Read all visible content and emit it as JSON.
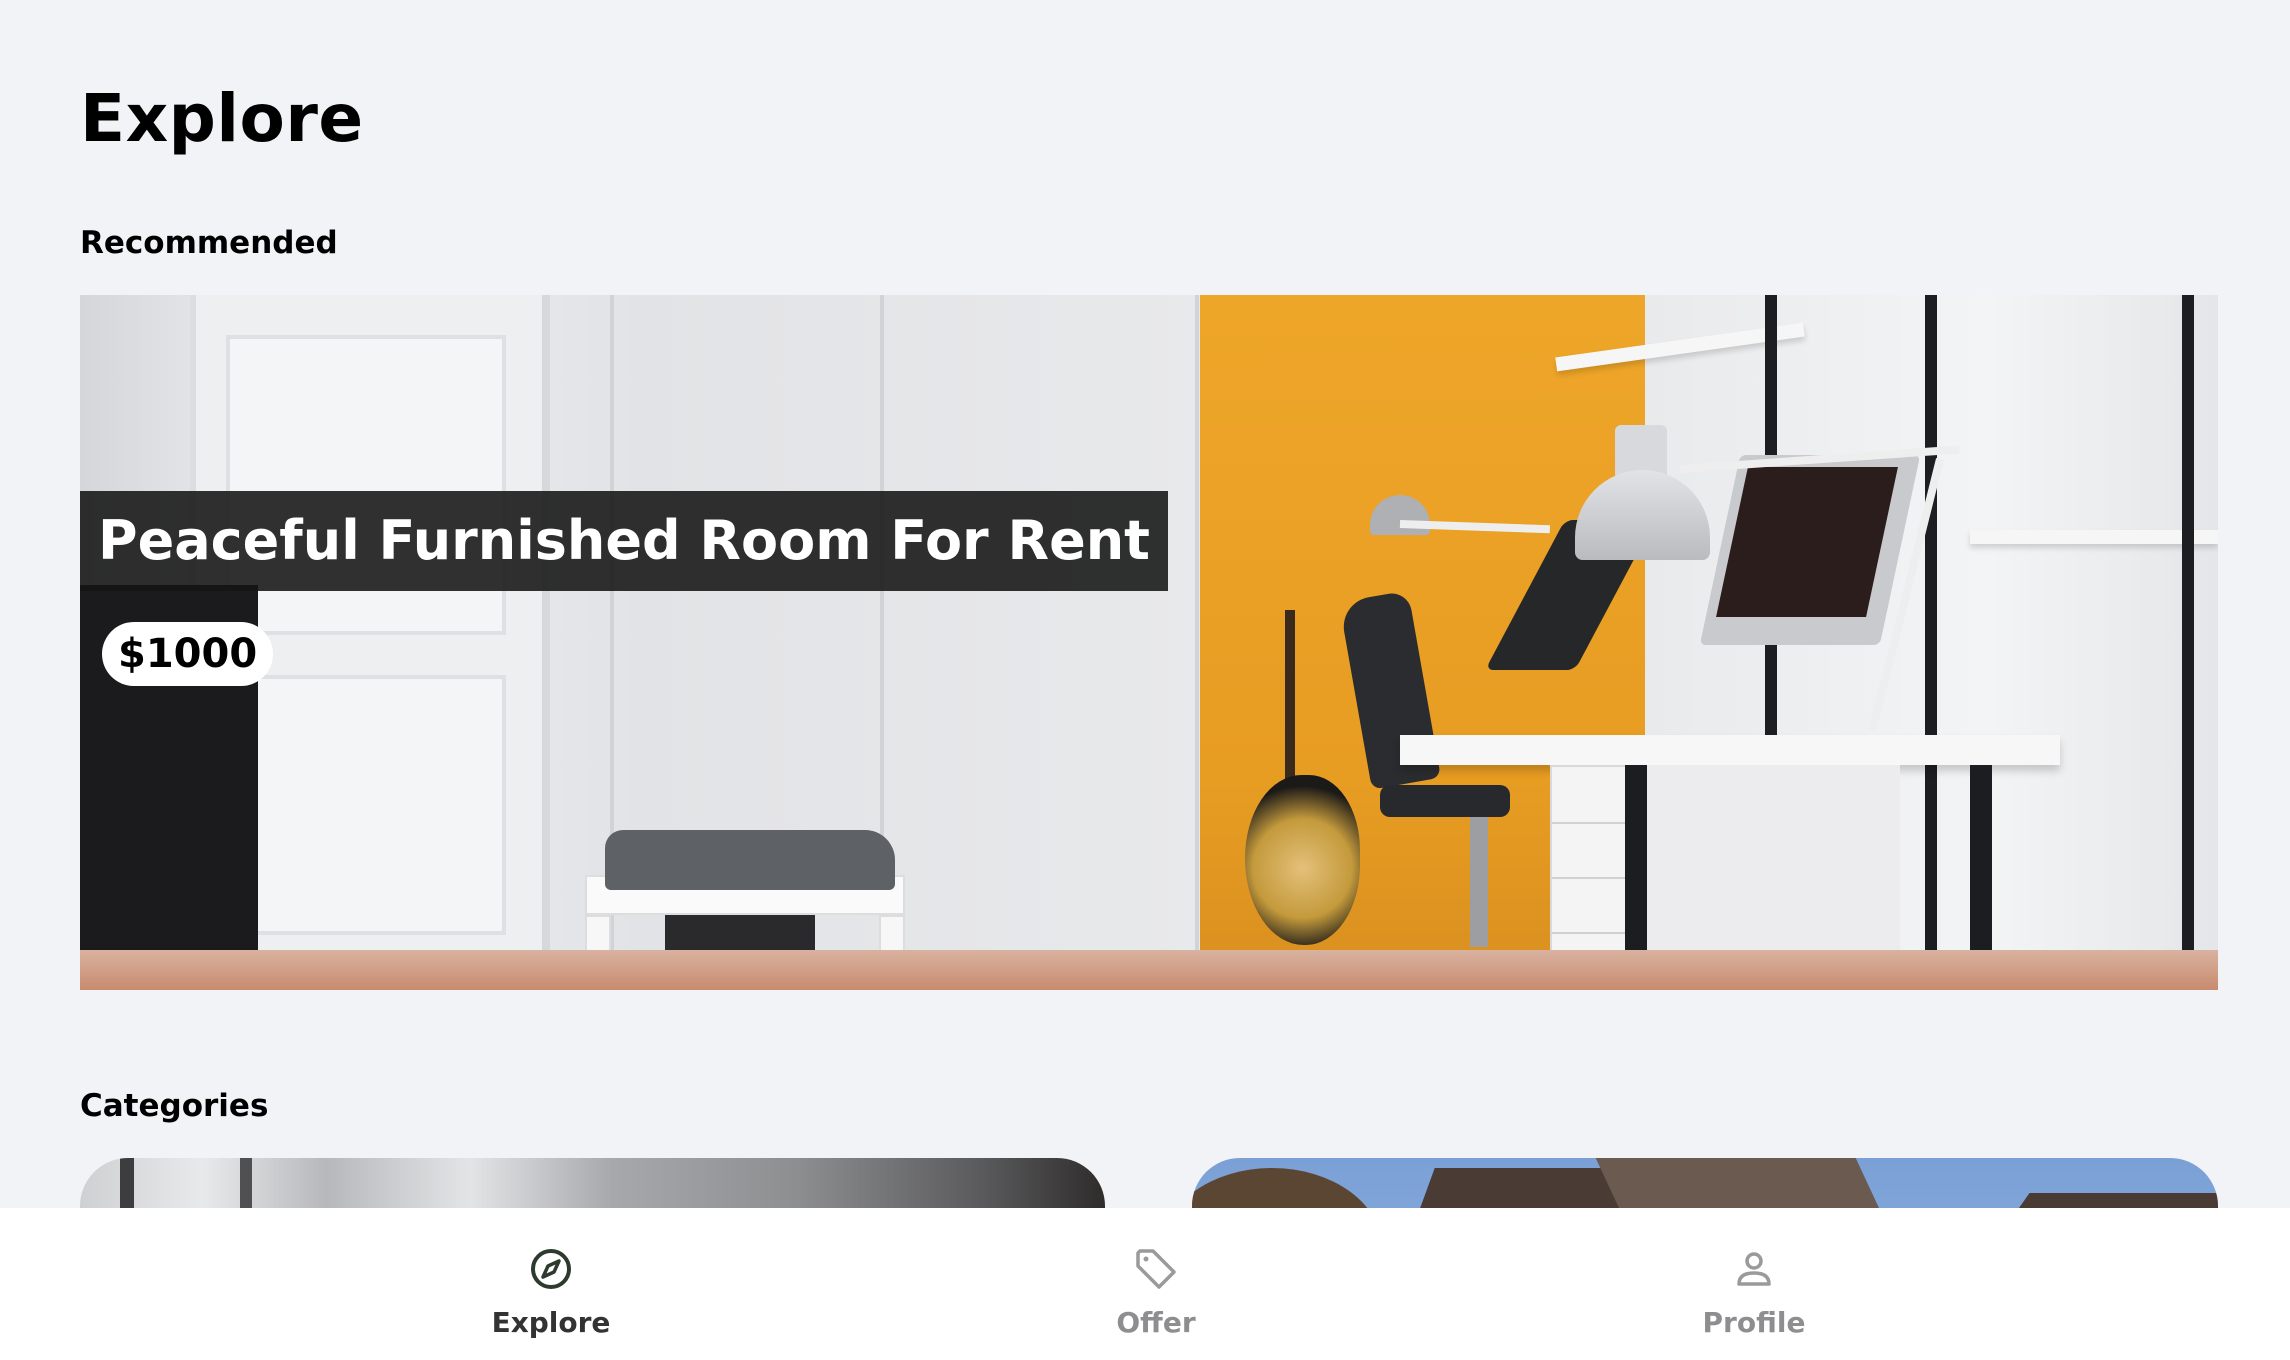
{
  "page": {
    "title": "Explore"
  },
  "sections": {
    "recommended": "Recommended",
    "categories": "Categories"
  },
  "featured": {
    "title": "Peaceful Furnished Room For Rent",
    "price": "$1000"
  },
  "nav": {
    "items": [
      {
        "label": "Explore",
        "icon": "compass-icon",
        "active": true
      },
      {
        "label": "Offer",
        "icon": "tag-icon",
        "active": false
      },
      {
        "label": "Profile",
        "icon": "person-icon",
        "active": false
      }
    ]
  },
  "colors": {
    "background": "#f2f3f7",
    "active_icon": "#2f3a2e",
    "inactive": "#8e8e90"
  }
}
